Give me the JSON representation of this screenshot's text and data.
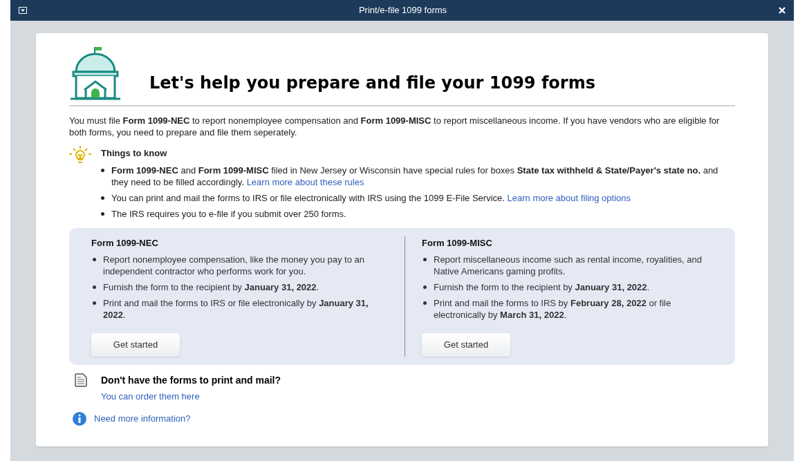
{
  "window": {
    "title": "Print/e-file 1099 forms"
  },
  "heading": "Let's help you prepare and file your 1099 forms",
  "intro": "You must file **Form 1099-NEC** to report nonemployee compensation and **Form 1099-MISC** to report miscellaneous income. If you have vendors who are eligible for both forms, you need to prepare and file them seperately.",
  "things_to_know": {
    "title": "Things to know",
    "items": [
      {
        "text": "**Form 1099-NEC** and **Form 1099-MISC** filed in New Jersey or Wisconsin have special rules for boxes **State tax withheld & State/Payer's state no.** and they need to be filled accordingly.",
        "link": "Learn more about these rules"
      },
      {
        "text": "You can print and mail the forms to IRS or file electronically with IRS using the 1099 E-File Service.",
        "link": "Learn more about filing options"
      },
      {
        "text": "The IRS requires you to e-file if you submit over 250 forms."
      }
    ]
  },
  "forms": [
    {
      "title": "Form 1099-NEC",
      "items": [
        "Report nonemployee compensation, like the money you pay to an independent contractor who performs work for you.",
        "Furnish the form to the recipient by **January 31, 2022**.",
        "Print and mail the forms to IRS or file electronically by **January 31, 2022**."
      ],
      "button": "Get started"
    },
    {
      "title": "Form 1099-MISC",
      "items": [
        "Report miscellaneous income such as rental income, royalities, and Native Americans gaming profits.",
        "Furnish the form to the recipient by **January 31, 2022**.",
        "Print and mail the forms to IRS by **February 28, 2022** or file electronically by **March 31, 2022**."
      ],
      "button": "Get started"
    }
  ],
  "order": {
    "title": "Don't have the forms to print and mail?",
    "link": "You can order them here"
  },
  "more_info": "Need more information?"
}
